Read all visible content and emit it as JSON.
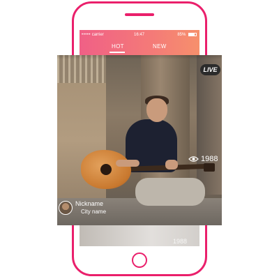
{
  "statusbar": {
    "carrier": "carrier",
    "signal_dots": "•••••",
    "time": "16:47",
    "battery": "85%"
  },
  "tabs": [
    {
      "label": "HOT",
      "active": true
    },
    {
      "label": "NEW",
      "active": false
    }
  ],
  "stream": {
    "live_badge": "LIVE",
    "viewers": "1988",
    "nickname": "Nickname",
    "city": "City name"
  },
  "next_stream": {
    "viewers": "1988"
  },
  "colors": {
    "accent": "#ea1f6b",
    "header_start": "#f06086",
    "header_end": "#f6906c"
  },
  "icons": [
    "eye-icon",
    "battery-icon",
    "avatar"
  ]
}
